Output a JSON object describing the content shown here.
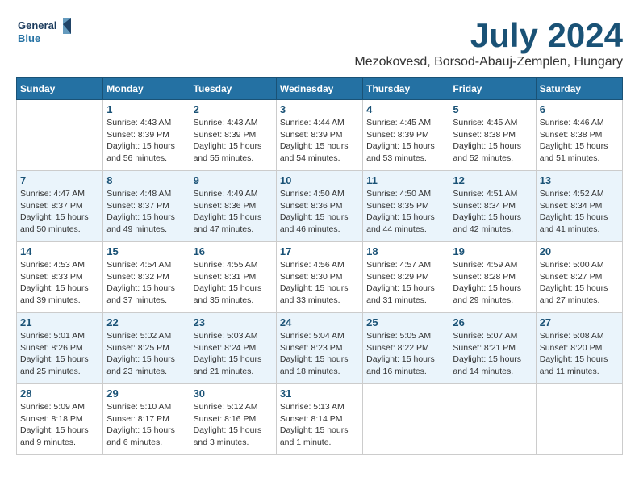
{
  "header": {
    "logo_line1": "General",
    "logo_line2": "Blue",
    "month": "July 2024",
    "location": "Mezokovesd, Borsod-Abauj-Zemplen, Hungary"
  },
  "columns": [
    "Sunday",
    "Monday",
    "Tuesday",
    "Wednesday",
    "Thursday",
    "Friday",
    "Saturday"
  ],
  "weeks": [
    [
      {
        "day": "",
        "info": ""
      },
      {
        "day": "1",
        "info": "Sunrise: 4:43 AM\nSunset: 8:39 PM\nDaylight: 15 hours\nand 56 minutes."
      },
      {
        "day": "2",
        "info": "Sunrise: 4:43 AM\nSunset: 8:39 PM\nDaylight: 15 hours\nand 55 minutes."
      },
      {
        "day": "3",
        "info": "Sunrise: 4:44 AM\nSunset: 8:39 PM\nDaylight: 15 hours\nand 54 minutes."
      },
      {
        "day": "4",
        "info": "Sunrise: 4:45 AM\nSunset: 8:39 PM\nDaylight: 15 hours\nand 53 minutes."
      },
      {
        "day": "5",
        "info": "Sunrise: 4:45 AM\nSunset: 8:38 PM\nDaylight: 15 hours\nand 52 minutes."
      },
      {
        "day": "6",
        "info": "Sunrise: 4:46 AM\nSunset: 8:38 PM\nDaylight: 15 hours\nand 51 minutes."
      }
    ],
    [
      {
        "day": "7",
        "info": "Sunrise: 4:47 AM\nSunset: 8:37 PM\nDaylight: 15 hours\nand 50 minutes."
      },
      {
        "day": "8",
        "info": "Sunrise: 4:48 AM\nSunset: 8:37 PM\nDaylight: 15 hours\nand 49 minutes."
      },
      {
        "day": "9",
        "info": "Sunrise: 4:49 AM\nSunset: 8:36 PM\nDaylight: 15 hours\nand 47 minutes."
      },
      {
        "day": "10",
        "info": "Sunrise: 4:50 AM\nSunset: 8:36 PM\nDaylight: 15 hours\nand 46 minutes."
      },
      {
        "day": "11",
        "info": "Sunrise: 4:50 AM\nSunset: 8:35 PM\nDaylight: 15 hours\nand 44 minutes."
      },
      {
        "day": "12",
        "info": "Sunrise: 4:51 AM\nSunset: 8:34 PM\nDaylight: 15 hours\nand 42 minutes."
      },
      {
        "day": "13",
        "info": "Sunrise: 4:52 AM\nSunset: 8:34 PM\nDaylight: 15 hours\nand 41 minutes."
      }
    ],
    [
      {
        "day": "14",
        "info": "Sunrise: 4:53 AM\nSunset: 8:33 PM\nDaylight: 15 hours\nand 39 minutes."
      },
      {
        "day": "15",
        "info": "Sunrise: 4:54 AM\nSunset: 8:32 PM\nDaylight: 15 hours\nand 37 minutes."
      },
      {
        "day": "16",
        "info": "Sunrise: 4:55 AM\nSunset: 8:31 PM\nDaylight: 15 hours\nand 35 minutes."
      },
      {
        "day": "17",
        "info": "Sunrise: 4:56 AM\nSunset: 8:30 PM\nDaylight: 15 hours\nand 33 minutes."
      },
      {
        "day": "18",
        "info": "Sunrise: 4:57 AM\nSunset: 8:29 PM\nDaylight: 15 hours\nand 31 minutes."
      },
      {
        "day": "19",
        "info": "Sunrise: 4:59 AM\nSunset: 8:28 PM\nDaylight: 15 hours\nand 29 minutes."
      },
      {
        "day": "20",
        "info": "Sunrise: 5:00 AM\nSunset: 8:27 PM\nDaylight: 15 hours\nand 27 minutes."
      }
    ],
    [
      {
        "day": "21",
        "info": "Sunrise: 5:01 AM\nSunset: 8:26 PM\nDaylight: 15 hours\nand 25 minutes."
      },
      {
        "day": "22",
        "info": "Sunrise: 5:02 AM\nSunset: 8:25 PM\nDaylight: 15 hours\nand 23 minutes."
      },
      {
        "day": "23",
        "info": "Sunrise: 5:03 AM\nSunset: 8:24 PM\nDaylight: 15 hours\nand 21 minutes."
      },
      {
        "day": "24",
        "info": "Sunrise: 5:04 AM\nSunset: 8:23 PM\nDaylight: 15 hours\nand 18 minutes."
      },
      {
        "day": "25",
        "info": "Sunrise: 5:05 AM\nSunset: 8:22 PM\nDaylight: 15 hours\nand 16 minutes."
      },
      {
        "day": "26",
        "info": "Sunrise: 5:07 AM\nSunset: 8:21 PM\nDaylight: 15 hours\nand 14 minutes."
      },
      {
        "day": "27",
        "info": "Sunrise: 5:08 AM\nSunset: 8:20 PM\nDaylight: 15 hours\nand 11 minutes."
      }
    ],
    [
      {
        "day": "28",
        "info": "Sunrise: 5:09 AM\nSunset: 8:18 PM\nDaylight: 15 hours\nand 9 minutes."
      },
      {
        "day": "29",
        "info": "Sunrise: 5:10 AM\nSunset: 8:17 PM\nDaylight: 15 hours\nand 6 minutes."
      },
      {
        "day": "30",
        "info": "Sunrise: 5:12 AM\nSunset: 8:16 PM\nDaylight: 15 hours\nand 3 minutes."
      },
      {
        "day": "31",
        "info": "Sunrise: 5:13 AM\nSunset: 8:14 PM\nDaylight: 15 hours\nand 1 minute."
      },
      {
        "day": "",
        "info": ""
      },
      {
        "day": "",
        "info": ""
      },
      {
        "day": "",
        "info": ""
      }
    ]
  ]
}
